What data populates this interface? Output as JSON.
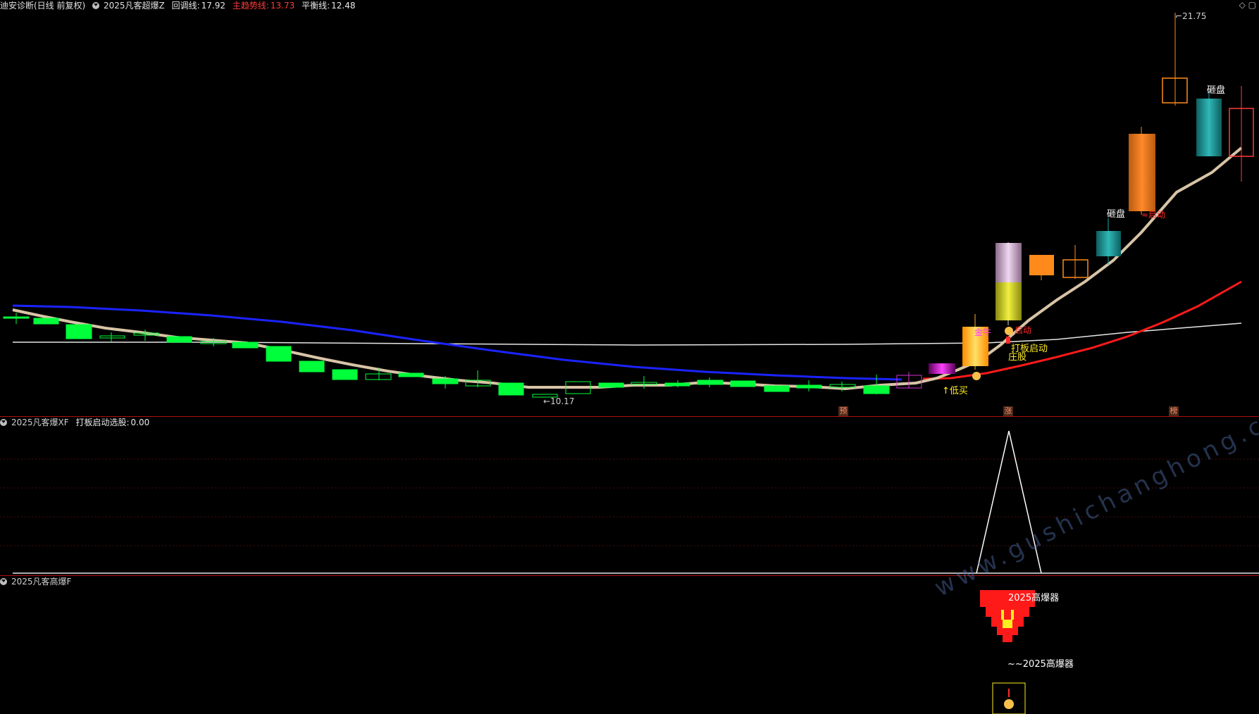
{
  "main": {
    "indicator": "迪安诊断(日线 前复权)",
    "formula": "2025凡客超爆Z",
    "huitiao_label": "回调线:",
    "huitiao_value": "17.92",
    "zhuqushi_label": "主趋势线:",
    "zhuqushi_value": "13.73",
    "pingheng_label": "平衡线:",
    "pingheng_value": "12.48",
    "price_high": "21.75",
    "price_low": "10.17",
    "labels": {
      "zapan1": "砸盘",
      "zapan2": "砸盘",
      "di_mai": "↑低买",
      "daban_qidong": "打板启动",
      "zhuang_gu": "庄股",
      "jin_niu": "金牛",
      "start_tag": "启动",
      "qiang_tag": "≈启动"
    },
    "markers": [
      "预",
      "涨",
      "榜"
    ]
  },
  "sub1": {
    "indicator": "2025凡客爆XF",
    "series_label": "打板启动选股:",
    "series_value": "0.00"
  },
  "sub2": {
    "indicator": "2025凡客高爆F",
    "label_top": "2025高爆器",
    "label_bottom": "~~2025高爆器"
  },
  "watermark": "www.gushichanghong.com",
  "colors": {
    "up": "#ff8a1c",
    "down": "#00ff3a",
    "teal": "#1ba7a7",
    "blue_line": "#1b23ff",
    "red_line": "#ff1a1a",
    "beige_line": "#d8c4a6",
    "white_line": "#e6e6e6"
  }
}
